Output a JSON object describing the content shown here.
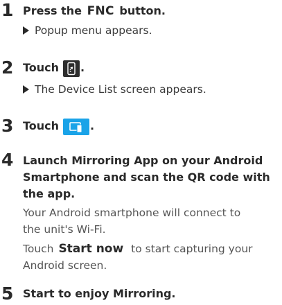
{
  "steps": [
    {
      "number": "1",
      "heading_pre": "Press the",
      "heading_key": "FNC",
      "heading_post": "button.",
      "result": "Popup menu appears."
    },
    {
      "number": "2",
      "heading_pre": "Touch",
      "icon": "device-list-phone-icon",
      "heading_post": ".",
      "result": "The Device List screen appears."
    },
    {
      "number": "3",
      "heading_pre": "Touch",
      "icon": "mirroring-screen-icon",
      "heading_post": "."
    },
    {
      "number": "4",
      "heading_lines": [
        "Launch Mirroring App on your Android",
        "Smartphone and scan the QR code with",
        "the app."
      ],
      "paragraph_1_lines": [
        "Your Android smartphone will connect to",
        "the unit's Wi-Fi."
      ],
      "paragraph_2_pre": "Touch",
      "paragraph_2_key": "Start now",
      "paragraph_2_post": "to start capturing your",
      "paragraph_2_line2": "Android screen."
    },
    {
      "number": "5",
      "heading": "Start to enjoy Mirroring."
    }
  ],
  "colors": {
    "icon_dark_bg": "#2e2e2e",
    "icon_blue_bg": "#1aa3e8",
    "text_primary": "#2a2a2a",
    "text_secondary": "#555555"
  }
}
